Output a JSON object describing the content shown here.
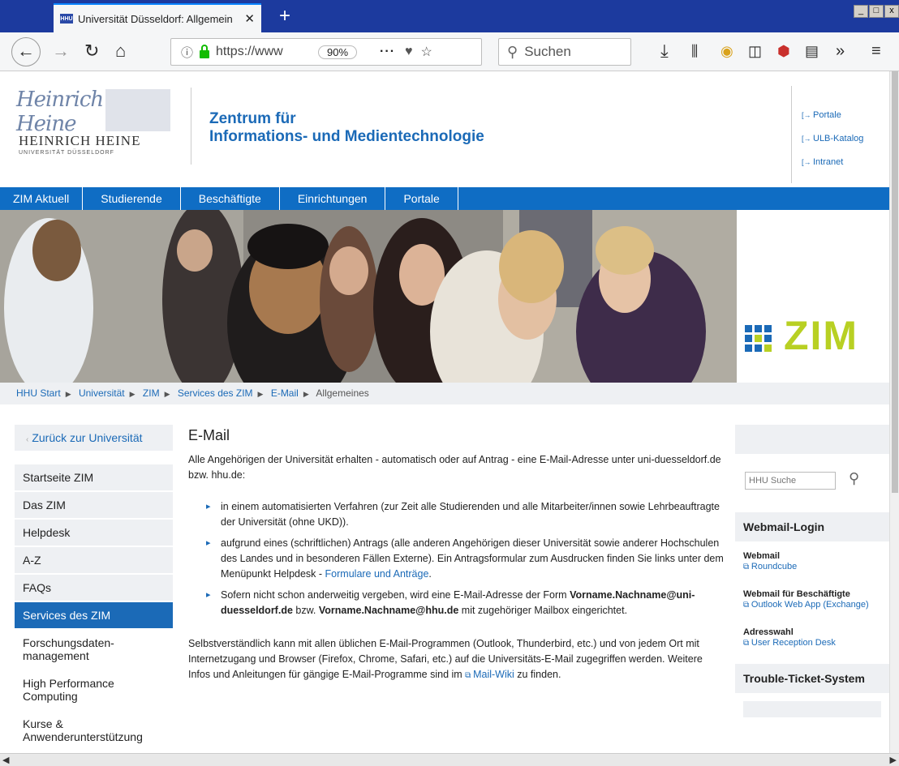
{
  "browser": {
    "tab_title": "Universität Düsseldorf: Allgemein",
    "url": "https://www",
    "zoom": "90%",
    "search_placeholder": "Suchen"
  },
  "header": {
    "logo_signature": "Heinrich Heine",
    "logo_name": "HEINRICH HEINE",
    "logo_sub": "UNIVERSITÄT DÜSSELDORF",
    "title_line1": "Zentrum für",
    "title_line2": "Informations- und Medientechnologie",
    "quicklinks": [
      "Portale",
      "ULB-Katalog",
      "Intranet"
    ]
  },
  "nav": [
    "ZIM Aktuell",
    "Studierende",
    "Beschäftigte",
    "Einrichtungen",
    "Portale"
  ],
  "banner_logo": "ZIM",
  "breadcrumb": [
    "HHU Start",
    "Universität",
    "ZIM",
    "Services des ZIM",
    "E-Mail",
    "Allgemeines"
  ],
  "sidebar": {
    "back": "Zurück zur Universität",
    "items": [
      "Startseite ZIM",
      "Das ZIM",
      "Helpdesk",
      "A-Z",
      "FAQs",
      "Services des ZIM",
      "Forschungsdaten-management",
      "High Performance Computing",
      "Kurse & Anwenderunterstützung"
    ]
  },
  "main": {
    "heading": "E-Mail",
    "intro": "Alle Angehörigen der Universität erhalten - automatisch oder auf Antrag - eine E-Mail-Adresse unter uni-duesseldorf.de bzw. hhu.de:",
    "bullet1": "in einem automatisierten Verfahren (zur Zeit alle Studierenden und alle Mitarbeiter/innen sowie Lehrbeauftragte der Universität (ohne UKD)).",
    "bullet2_text": "aufgrund eines (schriftlichen) Antrags (alle anderen Angehörigen dieser Universität sowie anderer Hochschulen des Landes und in besonderen Fällen Externe). Ein Antragsformular zum Ausdrucken finden Sie links unter dem Menüpunkt Helpdesk - ",
    "bullet2_link": "Formulare und Anträge",
    "bullet3_a": "Sofern nicht schon anderweitig vergeben, wird eine E-Mail-Adresse der Form ",
    "bullet3_addr1": "Vorname.Nachname@uni-duesseldorf.de",
    "bullet3_b": " bzw. ",
    "bullet3_addr2": "Vorname.Nachname@hhu.de",
    "bullet3_c": " mit zugehöriger Mailbox eingerichtet.",
    "last_text": "Selbstverständlich kann mit allen üblichen E-Mail-Programmen (Outlook, Thunderbird, etc.) und von jedem Ort mit Internetzugang und Browser (Firefox, Chrome, Safari, etc.) auf die Universitäts-E-Mail zugegriffen werden. Weitere Infos und Anleitungen für gängige E-Mail-Programme sind im ",
    "last_link": "Mail-Wiki",
    "last_end": " zu finden."
  },
  "right": {
    "search_placeholder": "HHU Suche",
    "webmail_title": "Webmail-Login",
    "webmail_label": "Webmail",
    "webmail_link": "Roundcube",
    "staff_label": "Webmail für Beschäftigte",
    "staff_link": "Outlook Web App (Exchange)",
    "address_label": "Adresswahl",
    "address_link": "User Reception Desk",
    "ticket_title": "Trouble-Ticket-System"
  },
  "colors": {
    "brand_blue": "#0f6dc4",
    "zim_green": "#b8d023",
    "browser_titlebar": "#1c3a9e"
  }
}
